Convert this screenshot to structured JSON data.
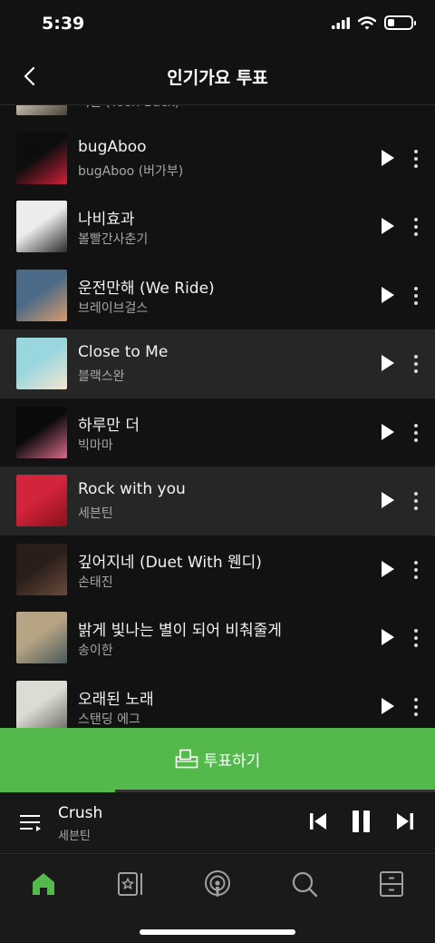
{
  "status": {
    "time": "5:39"
  },
  "header": {
    "title": "인기가요 투표",
    "back_icon": "chevron-left-icon"
  },
  "songs": [
    {
      "title": "",
      "artist": "백현 (Yoon Back)",
      "highlighted": false,
      "art": [
        "#c9c2b3",
        "#4a4238"
      ]
    },
    {
      "title": "bugAboo",
      "artist": "bugAboo (버가부)",
      "highlighted": false,
      "art": [
        "#0d0d0d",
        "#d0203a"
      ]
    },
    {
      "title": "나비효과",
      "artist": "볼빨간사춘기",
      "highlighted": false,
      "art": [
        "#ececec",
        "#2b2b2b"
      ]
    },
    {
      "title": "운전만해 (We Ride)",
      "artist": "브레이브걸스",
      "highlighted": false,
      "art": [
        "#4a6a88",
        "#d89a6a"
      ]
    },
    {
      "title": "Close to Me",
      "artist": "블랙스완",
      "highlighted": true,
      "art": [
        "#9ad6de",
        "#f4e6cf"
      ]
    },
    {
      "title": "하루만 더",
      "artist": "빅마마",
      "highlighted": false,
      "art": [
        "#0a0a0a",
        "#d86a8a"
      ]
    },
    {
      "title": "Rock with you",
      "artist": "세븐틴",
      "highlighted": true,
      "art": [
        "#d2243a",
        "#8a101a"
      ]
    },
    {
      "title": "깊어지네 (Duet With 웬디)",
      "artist": "손태진",
      "highlighted": false,
      "art": [
        "#2a1e1a",
        "#6a4a3a"
      ]
    },
    {
      "title": "밝게 빛나는 별이 되어 비춰줄게",
      "artist": "송이한",
      "highlighted": false,
      "art": [
        "#b6a484",
        "#4a5a5a"
      ]
    },
    {
      "title": "오래된 노래",
      "artist": "스탠딩 에그",
      "highlighted": false,
      "art": [
        "#dcdcd4",
        "#6a6a62"
      ]
    }
  ],
  "vote_button": {
    "label": "투표하기",
    "icon": "ballot-box-icon",
    "color": "#53b94a"
  },
  "now_playing": {
    "title": "Crush",
    "artist": "세븐틴",
    "progress": 0.265
  },
  "controls": {
    "prev": "skip-previous-icon",
    "pause": "pause-icon",
    "next": "skip-next-icon"
  },
  "tabs": [
    "home-icon",
    "library-icon",
    "podcast-icon",
    "search-icon",
    "storage-icon"
  ],
  "colors": {
    "accent": "#53b94a",
    "background": "#121212",
    "row_highlight": "#262626"
  }
}
